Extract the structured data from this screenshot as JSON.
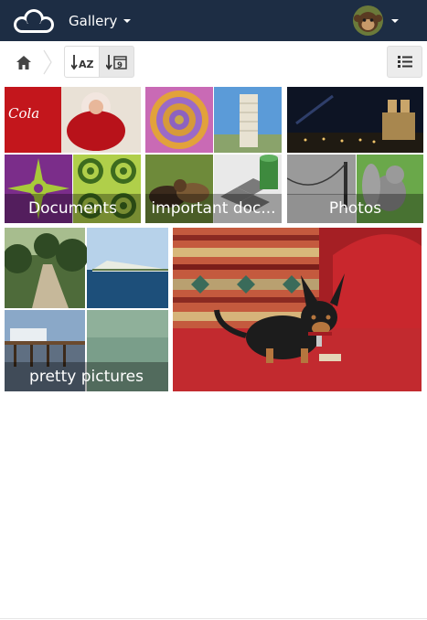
{
  "header": {
    "app_name": "Gallery",
    "logo_icon": "owncloud-cloud-logo",
    "background": "#1d2d44"
  },
  "controls": {
    "home_icon": "home-icon",
    "sort_name_icon": "sort-alpha-icon",
    "sort_date_icon": "sort-date-icon",
    "view_toggle_icon": "list-view-icon"
  },
  "albums": [
    {
      "name": "Documents"
    },
    {
      "name": "important doc..."
    },
    {
      "name": "Photos"
    },
    {
      "name": "pretty pictures"
    }
  ],
  "photos": [
    {
      "name": "dog-on-couch"
    }
  ]
}
